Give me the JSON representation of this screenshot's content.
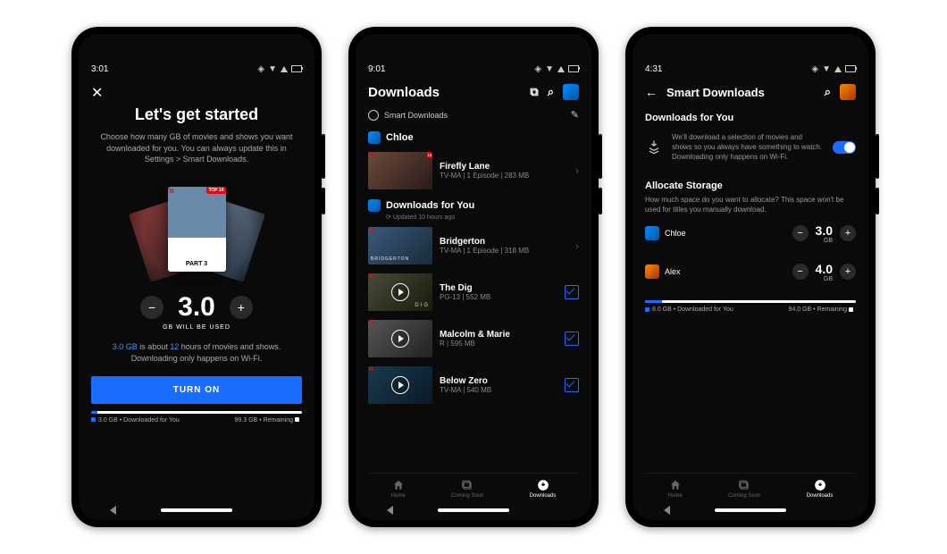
{
  "screen1": {
    "time": "3:01",
    "title": "Let's get started",
    "subtitle": "Choose how many GB of movies and shows you want downloaded for you. You can always update this in Settings > Smart Downloads.",
    "poster_label": "PART 3",
    "top10": "TOP 10",
    "amount": "3.0",
    "gb_label": "GB WILL BE USED",
    "info_hl": "3.0 GB",
    "info_mid": " is about ",
    "info_hrs": "12",
    "info_rest": " hours of movies and shows. Downloading only happens on Wi-Fi.",
    "cta": "TURN ON",
    "legend_left": "3.0 GB • Downloaded for You",
    "legend_right": "99.3 GB • Remaining"
  },
  "screen2": {
    "time": "9:01",
    "title": "Downloads",
    "smart_label": "Smart Downloads",
    "profile": "Chloe",
    "row1_title": "Firefly Lane",
    "row1_meta": "TV-MA | 1 Episode | 283 MB",
    "dfy_title": "Downloads for You",
    "dfy_meta": "Updated 10 hours ago",
    "row2_title": "Bridgerton",
    "row2_meta": "TV-MA | 1 Episode | 318 MB",
    "row2_thumb": "BRIDGERTON",
    "row3_title": "The Dig",
    "row3_meta": "PG-13 | 552 MB",
    "row3_thumb": "DIG",
    "row4_title": "Malcolm & Marie",
    "row4_meta": "R | 595 MB",
    "row5_title": "Below Zero",
    "row5_meta": "TV-MA | 540 MB",
    "tab1": "Home",
    "tab2": "Coming Soon",
    "tab3": "Downloads"
  },
  "screen3": {
    "time": "4:31",
    "title": "Smart Downloads",
    "section1": "Downloads for You",
    "desc1": "We'll download a selection of movies and shows so you always have something to watch. Downloading only happens on Wi-Fi.",
    "section2": "Allocate Storage",
    "desc2": "How much space do you want to allocate? This space won't be used for titles you manually download.",
    "p1_name": "Chloe",
    "p1_amt": "3.0",
    "p2_name": "Alex",
    "p2_amt": "4.0",
    "unit": "GB",
    "legend_left": "8.0 GB • Downloaded for You",
    "legend_right": "94.0 GB • Remaining",
    "tab1": "Home",
    "tab2": "Coming Soon",
    "tab3": "Downloads"
  }
}
